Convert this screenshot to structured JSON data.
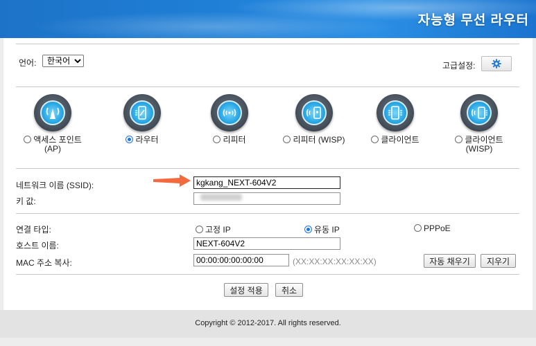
{
  "header": {
    "brand": "자능형 무선 라우터"
  },
  "top": {
    "language_label": "언어:",
    "language_value": "한국어",
    "advanced_label": "고급설정:"
  },
  "modes": [
    {
      "label": "액세스 포인트\n(AP)",
      "selected": false,
      "icon": "access-point-icon"
    },
    {
      "label": "라우터",
      "selected": true,
      "icon": "router-icon"
    },
    {
      "label": "리피터",
      "selected": false,
      "icon": "repeater-icon"
    },
    {
      "label": "리피터 (WISP)",
      "selected": false,
      "icon": "repeater-wisp-icon"
    },
    {
      "label": "클라이언트",
      "selected": false,
      "icon": "client-icon"
    },
    {
      "label": "클라이언트\n(WISP)",
      "selected": false,
      "icon": "client-wisp-icon"
    }
  ],
  "wireless": {
    "ssid_label": "네트워크 이름 (SSID):",
    "ssid_value": "kgkang_NEXT-604V2",
    "key_label": "키 값:"
  },
  "wan": {
    "conn_type_label": "연결 타입:",
    "options": [
      {
        "label": "고정 IP",
        "selected": false
      },
      {
        "label": "유동 IP",
        "selected": true
      },
      {
        "label": "PPPoE",
        "selected": false
      }
    ],
    "hostname_label": "호스트 이름:",
    "hostname_value": "NEXT-604V2",
    "mac_label": "MAC 주소 복사:",
    "mac_value": "00:00:00:00:00:00",
    "mac_hint": "(XX:XX:XX:XX:XX:XX)",
    "autofill_label": "자동 채우기",
    "clear_label": "지우기"
  },
  "actions": {
    "apply_label": "설정 적용",
    "cancel_label": "취소"
  },
  "footer": {
    "copyright": "Copyright © 2012-2017. All rights reserved."
  },
  "colors": {
    "header": "#1f7fd6",
    "accent": "#1a73e8",
    "arrow": "#f26a3d"
  }
}
